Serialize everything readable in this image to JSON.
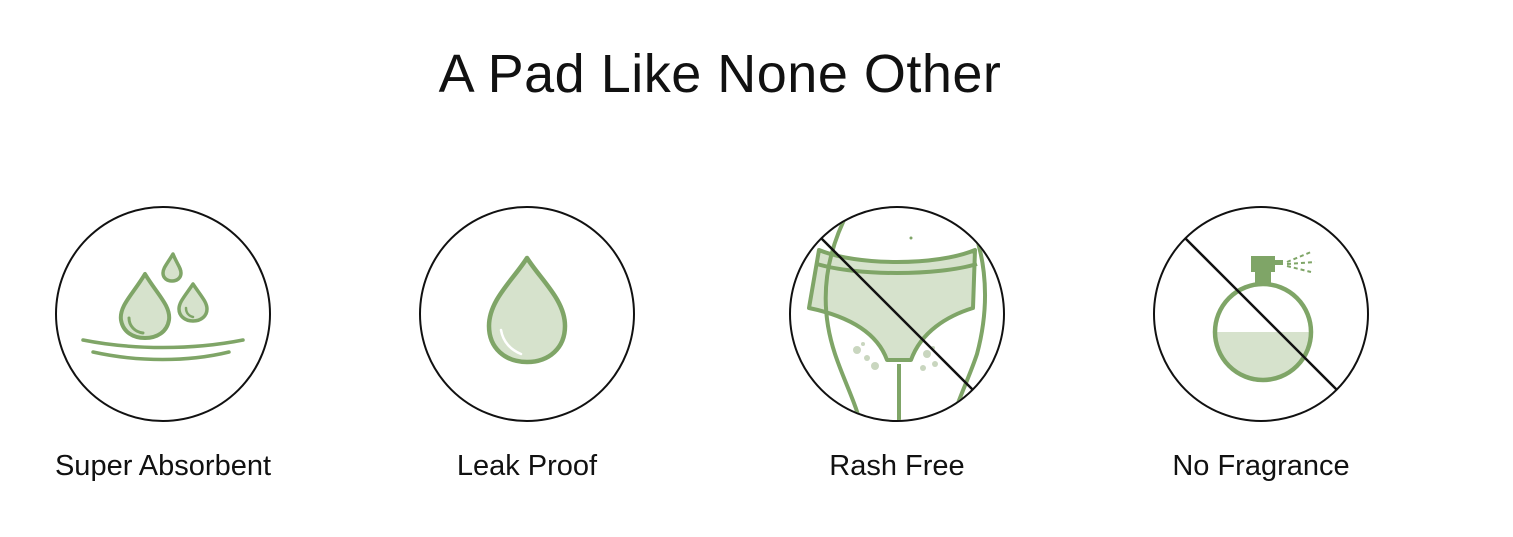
{
  "title": "A Pad Like None Other",
  "colors": {
    "accent": "#7fa567",
    "fill": "#d6e2cc",
    "ink": "#111111"
  },
  "features": [
    {
      "label": "Super Absorbent",
      "icon": "water-drops-icon"
    },
    {
      "label": "Leak Proof",
      "icon": "single-drop-icon"
    },
    {
      "label": "Rash Free",
      "icon": "no-rash-icon"
    },
    {
      "label": "No Fragrance",
      "icon": "no-fragrance-icon"
    }
  ]
}
